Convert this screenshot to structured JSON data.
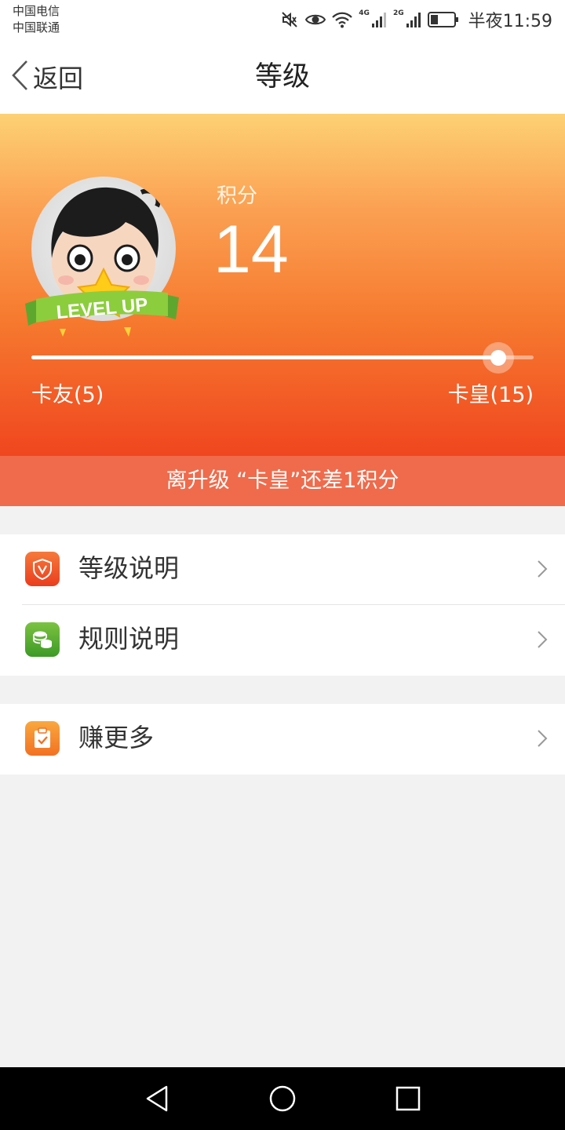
{
  "status_bar": {
    "carrier_1": "中国电信",
    "carrier_2": "中国联通",
    "network_1": "4G",
    "network_2": "2G",
    "time": "半夜11:59",
    "icons": [
      "mute-icon",
      "eye-icon",
      "wifi-icon",
      "signal-icon",
      "signal-icon",
      "battery-icon"
    ]
  },
  "header": {
    "back_label": "返回",
    "title": "等级"
  },
  "level_card": {
    "avatar_badge_text": "LEVEL UP",
    "points_label": "积分",
    "points_value": "14",
    "current_level": "卡友(5)",
    "next_level": "卡皇(15)",
    "progress_fraction": 0.93,
    "notice": "离升级 “卡皇”还差1积分"
  },
  "menu": {
    "group1": [
      {
        "label": "等级说明",
        "icon": "shield-v-icon",
        "icon_color": "#f0522a"
      },
      {
        "label": "规则说明",
        "icon": "coins-icon",
        "icon_color": "#5aac2e"
      }
    ],
    "group2": [
      {
        "label": "赚更多",
        "icon": "clipboard-check-icon",
        "icon_color": "#f5852c"
      }
    ]
  },
  "colors": {
    "hero_top": "#fdd174",
    "hero_bottom": "#f0461f",
    "notice_bg": "#ef6b4c",
    "page_bg": "#f2f2f2"
  },
  "nav": {
    "buttons": [
      "back-triangle-icon",
      "home-circle-icon",
      "recents-square-icon"
    ]
  }
}
